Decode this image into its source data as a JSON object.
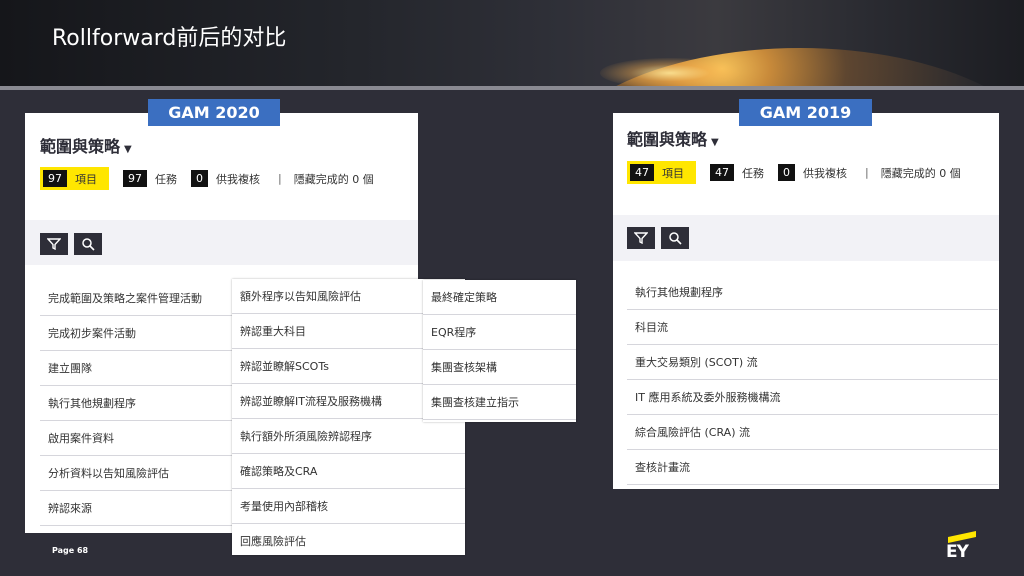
{
  "slide": {
    "title": "Rollforward前后的对比",
    "page": "Page 68",
    "logo": "EY"
  },
  "left": {
    "badge": "GAM 2020",
    "section_title": "範圍與策略",
    "stats": [
      {
        "count": "97",
        "label": "項目"
      },
      {
        "count": "97",
        "label": "任務"
      },
      {
        "count": "0",
        "label": "供我複核"
      }
    ],
    "separator": "|",
    "hidden_text": "隱藏完成的 0 個",
    "list_col1": [
      "完成範圍及策略之案件管理活動",
      "完成初步案件活動",
      "建立團隊",
      "執行其他規劃程序",
      "啟用案件資料",
      "分析資料以告知風險評估",
      "辨認來源"
    ],
    "list_col2": [
      "額外程序以告知風險評估",
      "辨認重大科目",
      "辨認並瞭解SCOTs",
      "辨認並瞭解IT流程及服務機構",
      "執行額外所須風險辨認程序",
      "確認策略及CRA",
      "考量使用內部稽核",
      "回應風險評估"
    ],
    "list_col3": [
      "最終確定策略",
      "EQR程序",
      "集團查核架構",
      "集團查核建立指示"
    ]
  },
  "right": {
    "badge": "GAM 2019",
    "section_title": "範圍與策略",
    "stats": [
      {
        "count": "47",
        "label": "項目"
      },
      {
        "count": "47",
        "label": "任務"
      },
      {
        "count": "0",
        "label": "供我複核"
      }
    ],
    "separator": "|",
    "hidden_text": "隱藏完成的 0 個",
    "list": [
      "執行其他規劃程序",
      "科目流",
      "重大交易類別 (SCOT) 流",
      "IT 應用系統及委外服務機構流",
      "綜合風險評估 (CRA) 流",
      "查核計畫流"
    ]
  },
  "icons": {
    "caret": "caret-down-icon",
    "filter": "filter-icon",
    "search": "search-icon"
  },
  "colors": {
    "accent_yellow": "#ffe600",
    "badge_blue": "#3b6fc1",
    "background": "#2e2e38"
  }
}
